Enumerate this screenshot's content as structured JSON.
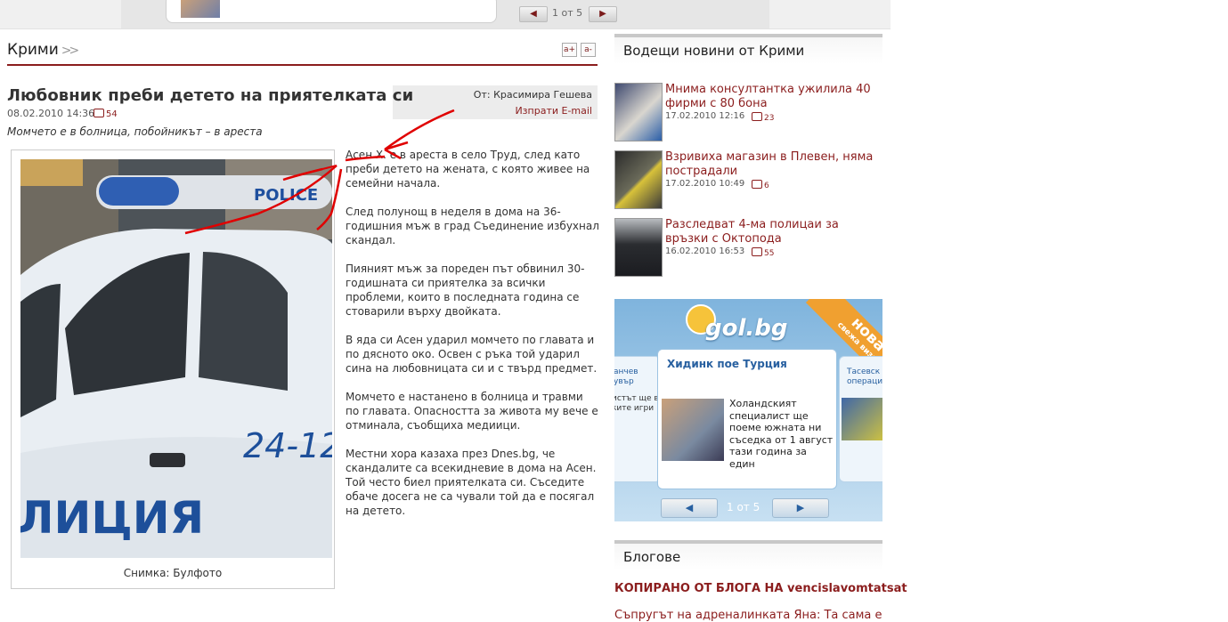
{
  "top_bar": {
    "pager_text": "1 от 5",
    "prev_label": "◀",
    "next_label": "▶"
  },
  "section": {
    "title": "Крими",
    "font_increase": "a+",
    "font_decrease": "a-"
  },
  "article": {
    "title": "Любовник преби детето на приятелката си",
    "author": "От: Красимира Гешева",
    "email_link": "Изпрати E-mail",
    "date": "08.02.2010 14:36",
    "comments": "54",
    "subtitle": "Момчето е в болница, побойникът – в ареста",
    "photo_caption": "Снимка: Булфото",
    "paragraphs": [
      "Асен Х. е в ареста в село Труд, след като преби детето на жената, с която живее на семейни начала.",
      "След полунощ в неделя в дома на 36-годишния мъж в град Съединение избухнал скандал.",
      "Пияният мъж за пореден път обвинил 30-годишната си приятелка за всички проблеми, които в последната година се стоварили върху двойката.",
      "В яда си Асен ударил момчето по главата и по дясното око. Освен с ръка той ударил сина на любовницата си и с твърд предмет.",
      "Момчето е настанено в болница и травми по главата. Опасността за живота му вече е отминала, съобщиха медиици.",
      "Местни хора казаха през Dnes.bg, че скандалите са всекидневие в дома на Асен. Той често биел приятелката си. Съседите обаче досега не са чували той да е посягал на детето."
    ],
    "photo_texts": {
      "police": "POLICE",
      "number": "24-12",
      "word": "ЛИЦИЯ"
    }
  },
  "sidebar": {
    "leading_title": "Водещи новини от Крими",
    "news": [
      {
        "title": "Мнима консултантка ужилила 40 фирми с 80 бона",
        "date": "17.02.2010 12:16",
        "comments": "23"
      },
      {
        "title": "Взривиха магазин в Плевен, няма пострадали",
        "date": "17.02.2010 10:49",
        "comments": "6"
      },
      {
        "title": "Разследват 4-ма полицаи за връзки с Октопода",
        "date": "16.02.2010 16:53",
        "comments": "55"
      }
    ],
    "gol_banner": {
      "logo": "gol.bg",
      "ribbon_main": "нова",
      "ribbon_sub": "свежа визия",
      "card_heading": "Хидинк пое Турция",
      "card_text": "Холандският специалист ще поеме южната ни съседка от 1 август тази година за един",
      "left_title": "анчев увър",
      "left_text": "истът ще в ките игри",
      "right_title": "Тасевск операци",
      "pager": "1 от 5",
      "prev_label": "◀",
      "next_label": "▶"
    },
    "blogs_title": "Блогове",
    "blog_items": [
      "КОПИРАНО ОТ БЛОГА НА vencislavomtatsat",
      "Съпругът на адреналинката Яна: Та сама е"
    ]
  }
}
